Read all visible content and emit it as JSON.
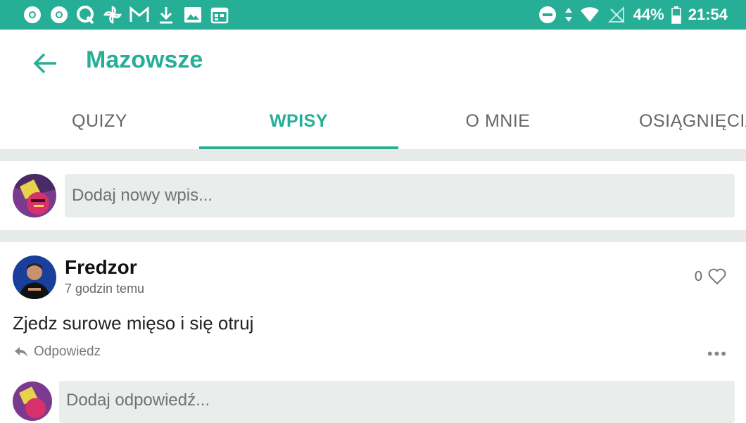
{
  "status_bar": {
    "battery": "44%",
    "time": "21:54",
    "left_icons": [
      "chrome-icon",
      "chrome-icon",
      "quora-icon",
      "pinwheel-icon",
      "gmail-icon",
      "download-icon",
      "image-icon",
      "calendar-icon"
    ],
    "right_icons": [
      "do-not-disturb-icon",
      "data-arrows-icon",
      "wifi-icon",
      "no-signal-icon",
      "battery-icon"
    ],
    "color": "#26ae96"
  },
  "app_bar": {
    "title": "Mazowsze"
  },
  "tabs": [
    {
      "label": "QUIZY",
      "active": false
    },
    {
      "label": "WPISY",
      "active": true
    },
    {
      "label": "O MNIE",
      "active": false
    },
    {
      "label": "OSIĄGNIĘCIA",
      "active": false
    }
  ],
  "composer": {
    "placeholder": "Dodaj nowy wpis..."
  },
  "post": {
    "author": "Fredzor",
    "time": "7 godzin temu",
    "likes": "0",
    "text": "Zjedz surowe mięso i się otruj",
    "reply_label": "Odpowiedz",
    "more_label": "•••"
  },
  "reply_composer": {
    "placeholder": "Dodaj odpowiedź..."
  },
  "colors": {
    "accent": "#26ae96",
    "divider": "#e6ebea",
    "input_bg": "#e9eeed"
  }
}
